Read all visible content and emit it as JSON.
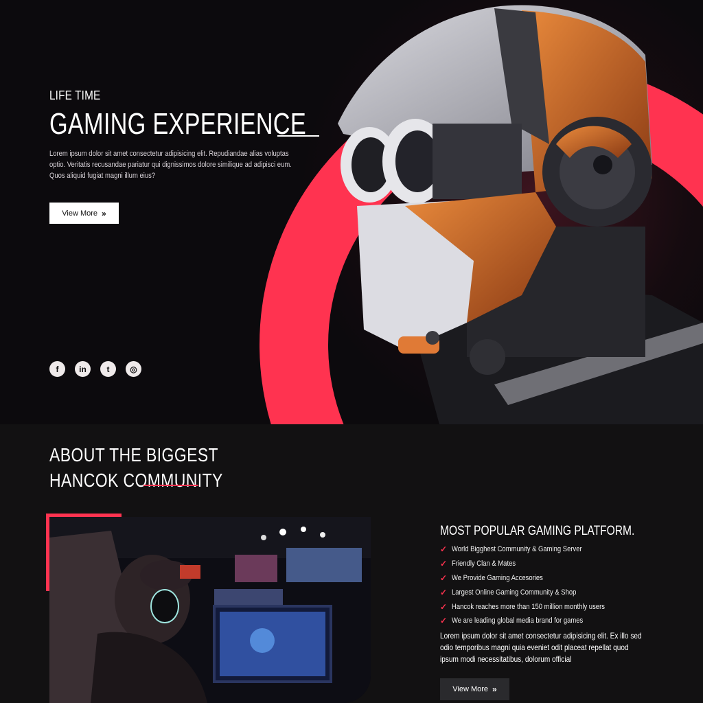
{
  "hero": {
    "subtitle": "LIFE TIME",
    "title": "GAMING EXPERIENCE",
    "description": "Lorem ipsum dolor sit amet consectetur adipisicing elit. Repudiandae alias voluptas optio. Veritatis recusandae pariatur qui dignissimos dolore similique ad adipisci eum. Quos aliquid fugiat magni illum eius?",
    "button_label": "View More",
    "button_icon": "double-chevron-right-icon",
    "socials": [
      {
        "name": "facebook-icon",
        "glyph": "f"
      },
      {
        "name": "linkedin-icon",
        "glyph": "in"
      },
      {
        "name": "twitter-icon",
        "glyph": "t"
      },
      {
        "name": "instagram-icon",
        "glyph": "◎"
      }
    ]
  },
  "about": {
    "title": "ABOUT THE BIGGEST HANCOK COMMUNITY",
    "feature_title": "MOST POPULAR GAMING PLATFORM.",
    "features": [
      "World Bigghest Community & Gaming Server",
      "Friendly Clan & Mates",
      "We Provide Gaming Accesories",
      "Largest Online Gaming Community & Shop",
      "Hancok reaches more than 150 million monthly users",
      "We are leading global media brand for games"
    ],
    "description": "Lorem ipsum dolor sit amet consectetur adipisicing elit. Ex illo sed odio temporibus magni quia eveniet odit placeat repellat quod ipsum modi necessitatibus, dolorum official",
    "button_label": "View More"
  },
  "colors": {
    "accent": "#ff3350",
    "background": "#0c0a0d",
    "section_bg": "#121112"
  }
}
